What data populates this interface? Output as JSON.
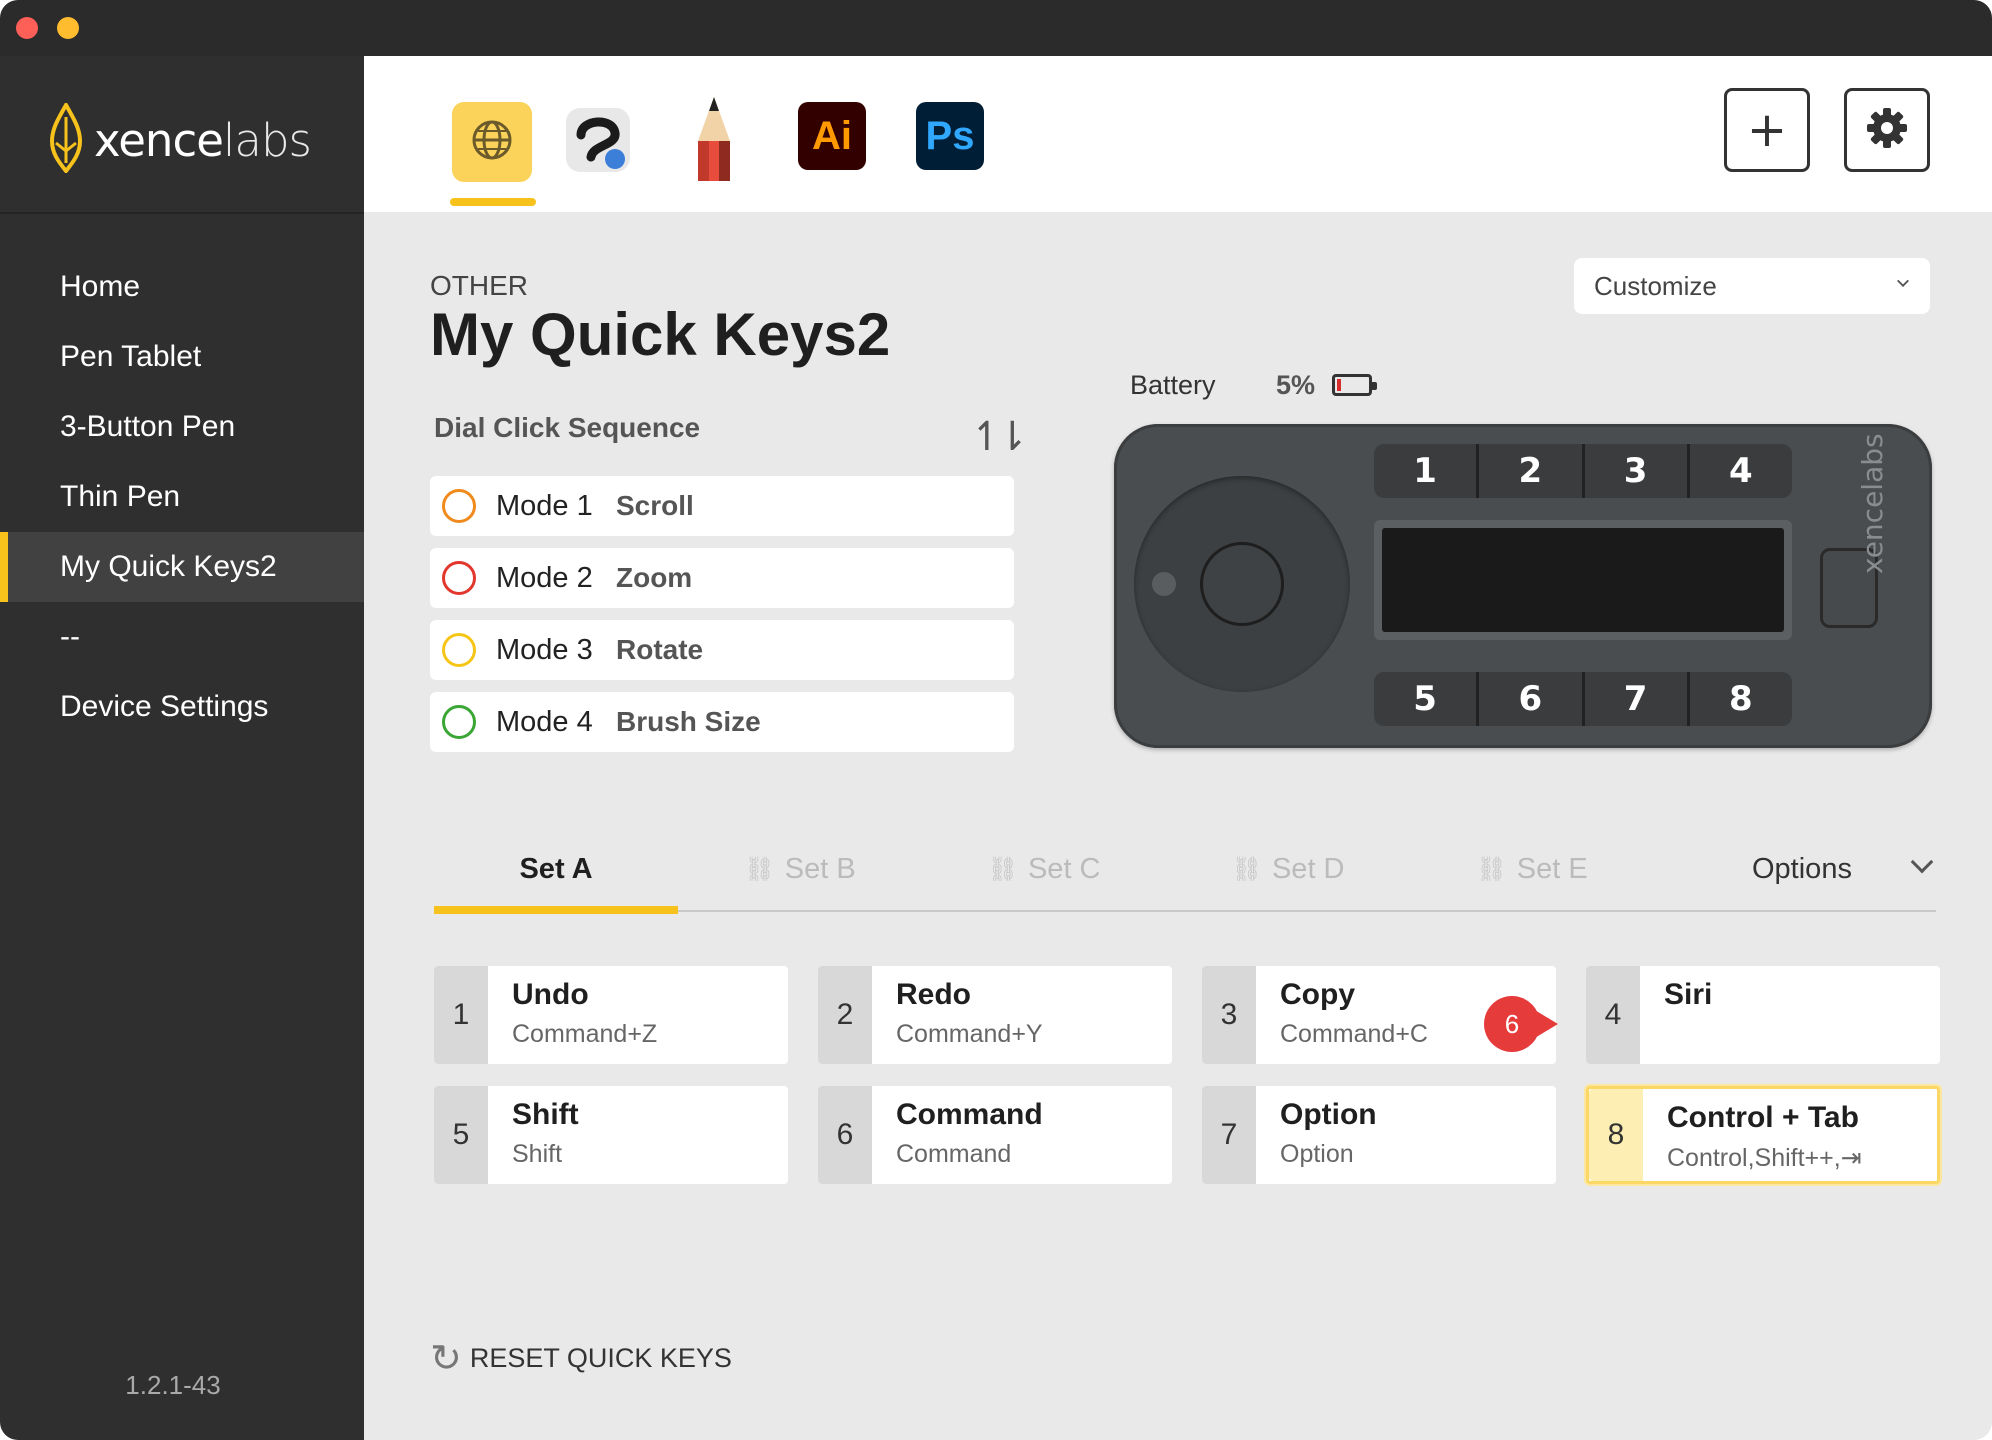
{
  "window": {
    "colors": {
      "traffic_red": "#fe5f57",
      "traffic_yellow": "#febc2e",
      "accent": "#f7c21b"
    }
  },
  "sidebar": {
    "logo": {
      "text_bold": "xence",
      "text_light": "labs",
      "icon": "xencelabs-logo-icon"
    },
    "items": [
      {
        "label": "Home"
      },
      {
        "label": "Pen Tablet"
      },
      {
        "label": "3-Button Pen"
      },
      {
        "label": "Thin Pen"
      },
      {
        "label": "My Quick Keys2",
        "active": true
      },
      {
        "label": "--"
      },
      {
        "label": "Device Settings"
      }
    ],
    "version": "1.2.1-43"
  },
  "appbar": {
    "apps": [
      {
        "name": "Global",
        "icon": "globe-icon",
        "active": true
      },
      {
        "name": "Clip Studio Paint",
        "icon": "clip-studio-icon"
      },
      {
        "name": "Sketch pencil",
        "icon": "pencil-icon"
      },
      {
        "name": "Illustrator",
        "label": "Ai"
      },
      {
        "name": "Photoshop",
        "label": "Ps"
      }
    ],
    "add_label": "+",
    "settings_icon": "gear-icon"
  },
  "profile": {
    "category": "OTHER",
    "title": "My Quick Keys2",
    "customize_label": "Customize"
  },
  "dial": {
    "label": "Dial Click Sequence",
    "sort_icon": "sort-arrows-icon",
    "modes": [
      {
        "name": "Mode 1",
        "action": "Scroll",
        "color": "#f08a1c"
      },
      {
        "name": "Mode 2",
        "action": "Zoom",
        "color": "#e2372c"
      },
      {
        "name": "Mode 3",
        "action": "Rotate",
        "color": "#f5c518"
      },
      {
        "name": "Mode 4",
        "action": "Brush Size",
        "color": "#3aa635"
      }
    ]
  },
  "battery": {
    "label": "Battery",
    "percent": "5%",
    "level": 0.05
  },
  "device": {
    "top_keys": [
      "1",
      "2",
      "3",
      "4"
    ],
    "bottom_keys": [
      "5",
      "6",
      "7",
      "8"
    ],
    "brand": "xencelabs"
  },
  "sets": {
    "tabs": [
      {
        "label": "Set A",
        "active": true
      },
      {
        "label": "Set B"
      },
      {
        "label": "Set C"
      },
      {
        "label": "Set D"
      },
      {
        "label": "Set E"
      }
    ],
    "options_label": "Options"
  },
  "keys": [
    {
      "num": "1",
      "action": "Undo",
      "shortcut": "Command+Z"
    },
    {
      "num": "2",
      "action": "Redo",
      "shortcut": "Command+Y"
    },
    {
      "num": "3",
      "action": "Copy",
      "shortcut": "Command+C"
    },
    {
      "num": "4",
      "action": "Siri",
      "shortcut": ""
    },
    {
      "num": "5",
      "action": "Shift",
      "shortcut": "Shift"
    },
    {
      "num": "6",
      "action": "Command",
      "shortcut": "Command"
    },
    {
      "num": "7",
      "action": "Option",
      "shortcut": "Option"
    },
    {
      "num": "8",
      "action": "Control + Tab",
      "shortcut": "Control,Shift++,⇥",
      "selected": true
    }
  ],
  "callout": {
    "number": "6"
  },
  "reset_label": "RESET QUICK KEYS"
}
